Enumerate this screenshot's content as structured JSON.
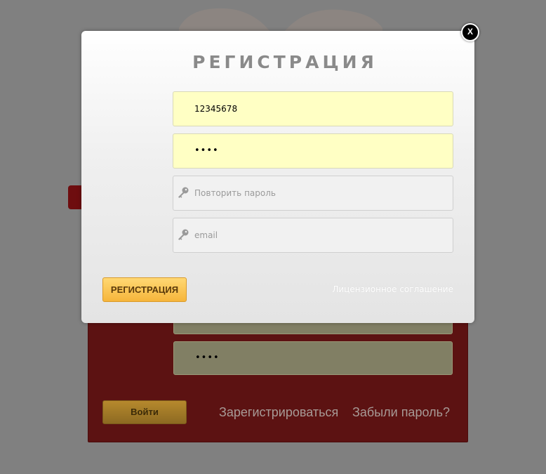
{
  "modal": {
    "title": "РЕГИСТРАЦИЯ",
    "close_label": "X",
    "fields": [
      {
        "value": "12345678",
        "placeholder": ""
      },
      {
        "value": "••••",
        "placeholder": ""
      },
      {
        "value": "",
        "placeholder": "Повторить пароль"
      },
      {
        "value": "",
        "placeholder": "email"
      }
    ],
    "submit_label": "РЕГИСТРАЦИЯ",
    "license_link": "Лицензионное соглашение"
  },
  "login": {
    "password_value": "••••",
    "login_button": "Войти",
    "register_link": "Зарегистрироваться",
    "forgot_link": "Забыли пароль?"
  },
  "colors": {
    "overlay": "#808080",
    "filled_field": "#ffffc4",
    "accent_button": "#f6b53b",
    "login_panel": "#5c1212"
  }
}
